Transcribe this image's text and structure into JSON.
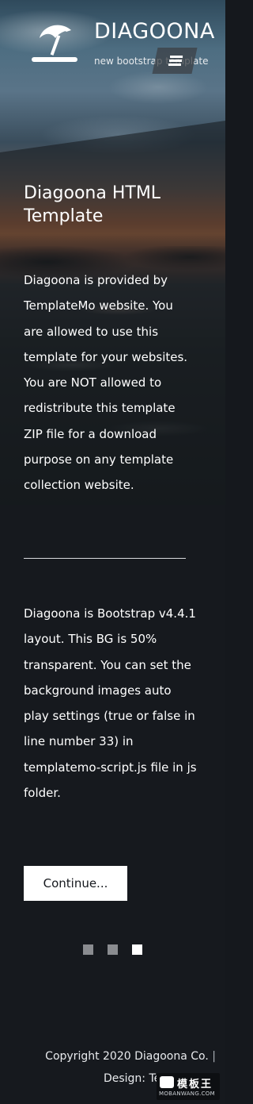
{
  "header": {
    "brand_name": "DIAGOONA",
    "tagline": "new bootstrap template",
    "logo_icon": "beach-umbrella-icon",
    "menu_icon": "hamburger-icon"
  },
  "main": {
    "title": "Diagoona HTML Template",
    "paragraph_1": "Diagoona is provided by TemplateMo website. You are allowed to use this template for your websites. You are NOT allowed to redistribute this template ZIP file for a download purpose on any template collection website.",
    "paragraph_2": "Diagoona is Bootstrap v4.4.1 layout. This BG is 50% transparent. You can set the background images auto play settings (true or false in line number 33) in templatemo-script.js file in js folder.",
    "continue_label": "Continue...",
    "slider_dots": {
      "count": 3,
      "active_index": 2
    }
  },
  "footer": {
    "copyright": "Copyright 2020 Diagoona Co.",
    "separator": "|",
    "design_credit": "Design: TemplateMo"
  },
  "watermark": {
    "top_text": "模板王",
    "bottom_text": "MOBANWANG.COM"
  },
  "colors": {
    "background": "#15181d",
    "text": "#ffffff",
    "button_bg": "#ffffff",
    "dot_inactive": "#8a8c90",
    "dot_active": "#ffffff"
  }
}
